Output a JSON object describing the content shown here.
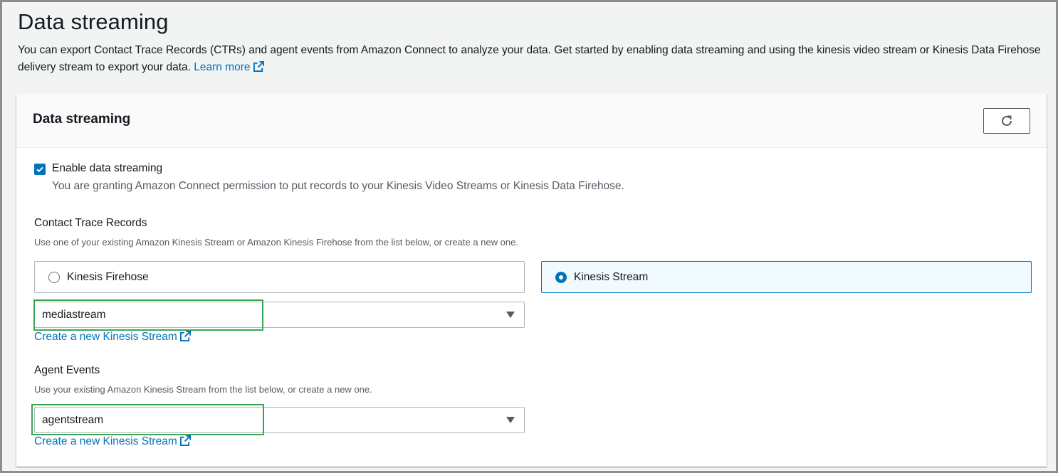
{
  "page": {
    "title": "Data streaming",
    "description": "You can export Contact Trace Records (CTRs) and agent events from Amazon Connect to analyze your data. Get started by enabling data streaming and using the kinesis video stream or Kinesis Data Firehose delivery stream to export your data.",
    "learn_more": "Learn more"
  },
  "panel": {
    "title": "Data streaming",
    "refresh_icon": "refresh-icon"
  },
  "enable": {
    "label": "Enable data streaming",
    "checked": true,
    "description": "You are granting Amazon Connect permission to put records to your Kinesis Video Streams or Kinesis Data Firehose."
  },
  "ctr": {
    "label": "Contact Trace Records",
    "description": "Use one of your existing Amazon Kinesis Stream or Amazon Kinesis Firehose from the list below, or create a new one.",
    "options": [
      {
        "label": "Kinesis Firehose",
        "selected": false
      },
      {
        "label": "Kinesis Stream",
        "selected": true
      }
    ],
    "select_value": "mediastream",
    "create_link": "Create a new Kinesis Stream"
  },
  "agent": {
    "label": "Agent Events",
    "description": "Use your existing Amazon Kinesis Stream from the list below, or create a new one.",
    "select_value": "agentstream",
    "create_link": "Create a new Kinesis Stream"
  },
  "colors": {
    "link": "#0073bb",
    "highlight": "#3aa655",
    "selected_tile_bg": "#f1faff"
  }
}
